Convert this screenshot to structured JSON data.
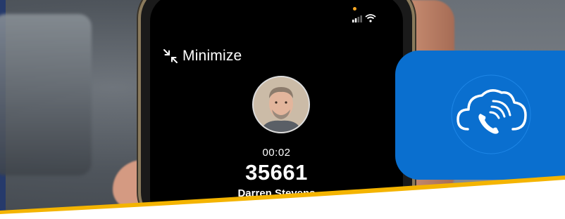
{
  "call_screen": {
    "minimize_label": "Minimize",
    "timer": "00:02",
    "number": "35661",
    "caller_name": "Darren Stevens"
  },
  "icons": {
    "minimize": "minimize-arrows-icon",
    "signal": "signal-bars-icon",
    "wifi": "wifi-icon",
    "cloud_phone": "cloud-phone-icon"
  },
  "colors": {
    "accent_blue": "#0a6fcf",
    "accent_yellow": "#f4b400",
    "screen_bg": "#000000"
  }
}
